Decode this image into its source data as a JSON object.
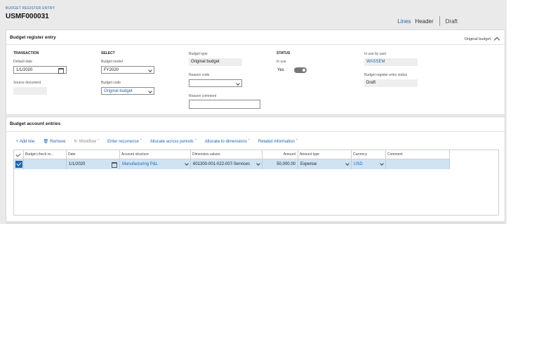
{
  "app": {
    "breadcrumb": "BUDGET REGISTER ENTRY",
    "record_id": "USMF000031",
    "views": {
      "lines": "Lines",
      "header": "Header",
      "status": "Draft"
    }
  },
  "entry_panel": {
    "title": "Budget register entry",
    "summary": "Original budget",
    "transaction": {
      "group_label": "TRANSACTION",
      "default_date_label": "Default date",
      "default_date_value": "1/1/2020",
      "source_document_label": "Source document",
      "source_document_value": ""
    },
    "select": {
      "group_label": "SELECT",
      "budget_model_label": "Budget model",
      "budget_model_value": "FY2020",
      "budget_code_label": "Budget code",
      "budget_code_value": "Original budget"
    },
    "type": {
      "budget_type_label": "Budget type",
      "budget_type_value": "Original budget",
      "reason_code_label": "Reason code",
      "reason_code_value": "",
      "reason_comment_label": "Reason comment",
      "reason_comment_value": ""
    },
    "status": {
      "group_label": "STATUS",
      "in_use_label": "In use",
      "in_use_value": "Yes",
      "in_use_on": true
    },
    "user": {
      "in_use_by_label": "In use by user",
      "in_use_by_value": "WASSEM",
      "entry_status_label": "Budget register entry status",
      "entry_status_value": "Draft"
    }
  },
  "accounts_panel": {
    "title": "Budget account entries",
    "toolbar": {
      "add_line": "+ Add line",
      "remove": "Remove",
      "workflow": "Workflow",
      "enter_recurrence": "Enter recurrence",
      "allocate_periods": "Allocate across periods",
      "allocate_dimensions": "Allocate to dimensions",
      "related_info": "Related information"
    },
    "columns": [
      "Budget check re...",
      "Date",
      "Account structure",
      "Dimension values",
      "Amount",
      "Amount type",
      "Currency",
      "Comment"
    ],
    "rows": [
      {
        "budget_check": "",
        "date": "1/1/2020",
        "account_structure": "Manufacturing P&L",
        "dimension_values": "601300-001-022-007-Services",
        "amount": "50,000.00",
        "amount_type": "Expense",
        "currency": "USD",
        "comment": ""
      }
    ]
  },
  "colors": {
    "accent": "#2266aa",
    "selected_row": "#cfe3f5",
    "app_background": "#eaeaea"
  }
}
